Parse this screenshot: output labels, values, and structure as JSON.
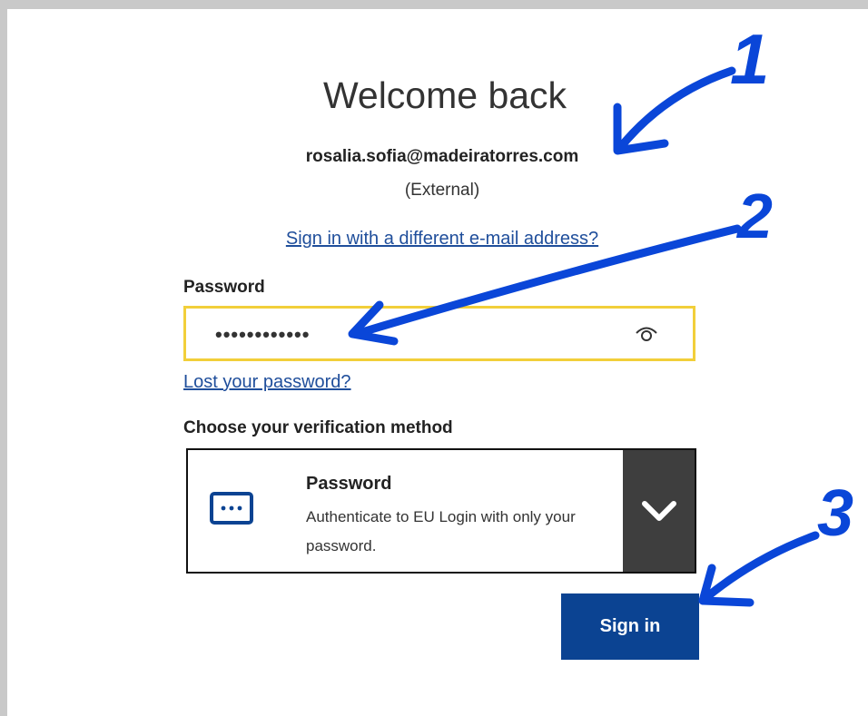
{
  "login": {
    "title": "Welcome back",
    "email": "rosalia.sofia@madeiratorres.com",
    "account_type": "(External)",
    "different_email_link": "Sign in with a different e-mail address?",
    "password_label": "Password",
    "password_masked": "••••••••••••",
    "lost_password_link": "Lost your password?",
    "verification_label": "Choose your verification method",
    "method": {
      "title": "Password",
      "description": "Authenticate to EU Login with only your password.",
      "icon": "password-dots-icon"
    },
    "signin_label": "Sign in"
  },
  "annotations": {
    "marker_1": "1",
    "marker_2": "2",
    "marker_3": "3",
    "color": "#0a46d8"
  },
  "colors": {
    "accent_blue": "#0b4392",
    "link_blue": "#1f4e9b",
    "focus_yellow": "#f2cf3a",
    "toggle_dark": "#3e3e3e"
  }
}
